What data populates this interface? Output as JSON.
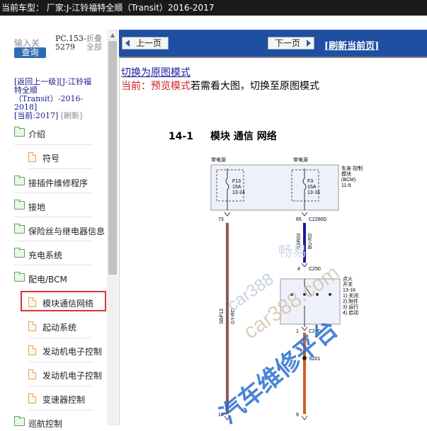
{
  "title_bar": "当前车型： 厂家:J-江铃福特全顺（Transit）2016-2017",
  "left_panel": {
    "search_label": "输入关",
    "search_button": "查询",
    "pc_code_lines": [
      "PC.153-",
      "5279"
    ],
    "fold_lines": [
      "折叠",
      "全部"
    ],
    "breadcrumb": {
      "back": "[返回上一级]",
      "model": "[J-江铃福特全顺（Transit）-2016-2018]",
      "current_label": "[当前:",
      "current_value": "2017]",
      "refresh": "[刷新]"
    },
    "tree": [
      {
        "label": "介绍",
        "type": "folder"
      },
      {
        "label": "符号",
        "type": "doc"
      },
      {
        "label": "接插件维修程序",
        "type": "folder"
      },
      {
        "label": "接地",
        "type": "folder"
      },
      {
        "label": "保险丝与继电器信息",
        "type": "folder"
      },
      {
        "label": "充电系统",
        "type": "folder"
      },
      {
        "label": "配电/BCM",
        "type": "folder"
      },
      {
        "label": "模块通信网络",
        "type": "doc",
        "selected": true
      },
      {
        "label": "起动系统",
        "type": "doc"
      },
      {
        "label": "发动机电子控制",
        "type": "doc"
      },
      {
        "label": "发动机电子控制",
        "type": "doc"
      },
      {
        "label": "变速器控制",
        "type": "doc"
      },
      {
        "label": "巡航控制",
        "type": "folder"
      }
    ]
  },
  "nav": {
    "prev_page": "上一页",
    "next_page": "下一页",
    "refresh_page": "[刷新当前页]"
  },
  "content": {
    "switch_link": "切换为原图模式",
    "current_mode_label": "当前：预览模式",
    "current_mode_hint": "若需看大图，切换至原图模式"
  },
  "diagram": {
    "section_number": "14-1",
    "section_title": "模块 通信 网络",
    "labels": {
      "power_left": "常电源",
      "power_right": "常电源",
      "bcm_lines": [
        "车身 控制",
        "模块",
        "(BCM)",
        "11-9"
      ],
      "fuse_left": [
        "F13",
        "15A",
        "13-24"
      ],
      "fuse_right": [
        "F3",
        "15A",
        "13-16"
      ],
      "pin_73": "73",
      "pin_65": "65",
      "conn_c2280d": "C2280D",
      "wire_sbp13": "SBP13",
      "wire_gyrd": "GY-RD",
      "wire_sbr03": "SBR03",
      "wire_burd": "BU-RD",
      "pin_4": "4",
      "conn_c250_top": "C250",
      "ignition_lines": [
        "点火",
        "开关",
        "13-16",
        "1) 关闭",
        "2) 附件",
        "3) 运行",
        "4) 启动"
      ],
      "pin_1": "1",
      "conn_c250_bot": "C250",
      "splice": "S201",
      "pin_16": "16",
      "pin_9": "9"
    }
  },
  "colors": {
    "title_bar_bg": "#1a1a1a",
    "nav_bg": "#1f4fa0",
    "search_button_bg": "#2e6db4",
    "highlight_border": "#e03030",
    "wire_gray_red": "#8a5a5a",
    "wire_blue_red": "#1a1aa0",
    "wire_orange": "#d06020"
  },
  "watermarks": [
    "畅易",
    "car388",
    "car388.com",
    "汽车维修平台"
  ]
}
